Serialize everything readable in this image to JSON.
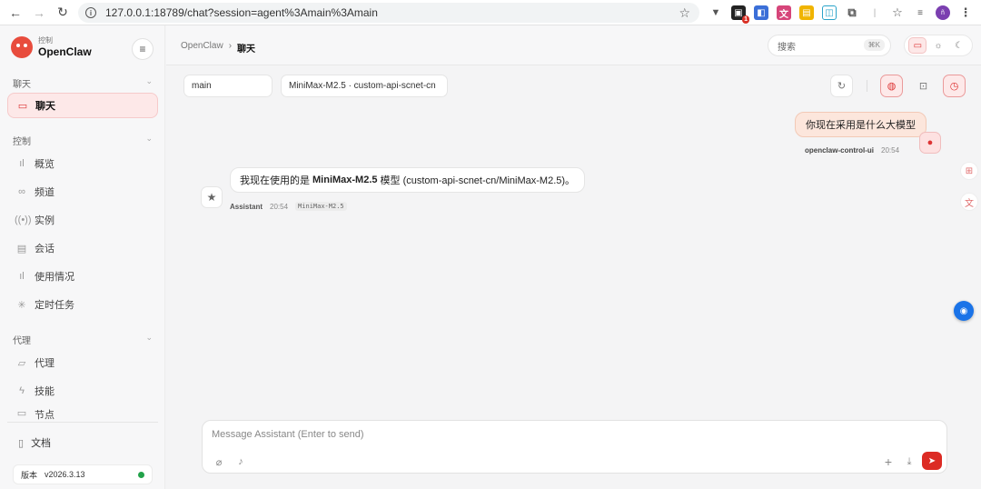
{
  "browser": {
    "url": "127.0.0.1:18789/chat?session=agent%3Amain%3Amain",
    "extension_badge": "1",
    "profile_initials": "ñ"
  },
  "sidebar": {
    "brand_sub": "控制",
    "brand_name": "OpenClaw",
    "sections": [
      {
        "label": "聊天",
        "items": [
          {
            "label": "聊天",
            "icon": "chat-icon"
          }
        ]
      },
      {
        "label": "控制",
        "items": [
          {
            "label": "概览",
            "icon": "bar-chart-icon"
          },
          {
            "label": "频道",
            "icon": "link-icon"
          },
          {
            "label": "实例",
            "icon": "signal-icon"
          },
          {
            "label": "会话",
            "icon": "document-icon"
          },
          {
            "label": "使用情况",
            "icon": "bar-chart-icon"
          },
          {
            "label": "定时任务",
            "icon": "loader-icon"
          }
        ]
      },
      {
        "label": "代理",
        "items": [
          {
            "label": "代理",
            "icon": "folder-icon"
          },
          {
            "label": "技能",
            "icon": "lightning-icon"
          },
          {
            "label": "节点",
            "icon": "monitor-icon"
          }
        ]
      }
    ],
    "docs_label": "文档",
    "version_label": "版本",
    "version_value": "v2026.3.13",
    "status_color": "#22a24a"
  },
  "topbar": {
    "breadcrumb_root": "OpenClaw",
    "breadcrumb_current": "聊天",
    "search_placeholder": "搜索",
    "search_shortcut": "⌘K"
  },
  "session": {
    "agent": "main",
    "model": "MiniMax-M2.5 · custom-api-scnet-cn"
  },
  "messages": {
    "user": {
      "text": "你现在采用是什么大模型",
      "sender": "openclaw-control-ui",
      "time": "20:54"
    },
    "assistant": {
      "text_before": "我现在使用的是",
      "model": "MiniMax-M2.5",
      "text_after": "模型 (custom-api-scnet-cn/MiniMax-M2.5)。",
      "sender": "Assistant",
      "time": "20:54",
      "model_tag": "MiniMax-M2.5"
    }
  },
  "composer": {
    "placeholder": "Message Assistant (Enter to send)"
  },
  "colors": {
    "accent": "#dc2b24",
    "active_bg": "#fde8e8",
    "user_bubble": "#fce6dc"
  }
}
